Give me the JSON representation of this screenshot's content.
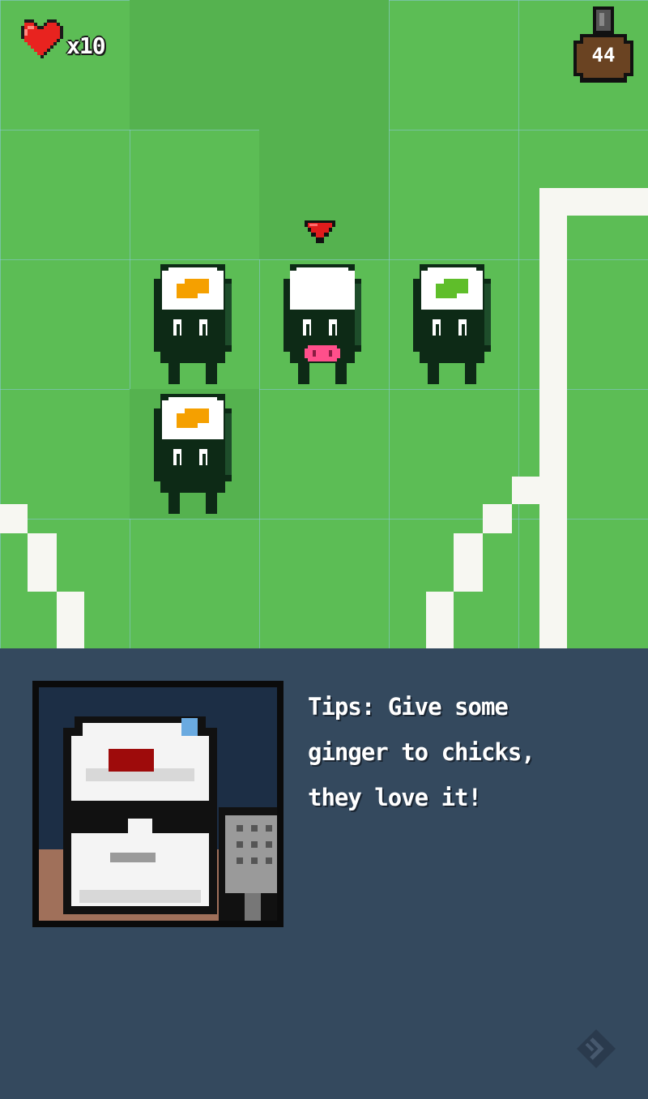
{
  "hud": {
    "lives_label": "x10",
    "bottle_count": "44"
  },
  "colors": {
    "grass": "#5cbd55",
    "grass_dark": "#55b24f",
    "path": "#f7f7f2",
    "seaweed": "#0d2a16",
    "rice": "#ffffff",
    "filling_orange": "#f5a000",
    "filling_green": "#5fbe2a",
    "panel": "#34495e",
    "heart": "#e8231f"
  },
  "units": [
    {
      "filling": "orange"
    },
    {
      "filling": "none",
      "selected": true
    },
    {
      "filling": "green"
    },
    {
      "filling": "orange"
    }
  ],
  "dialog": {
    "tip_lines": [
      "Tips: Give some",
      "ginger to chicks,",
      "they love it!"
    ],
    "speaker": "chef-portrait",
    "next_icon": "next-arrow-icon"
  }
}
